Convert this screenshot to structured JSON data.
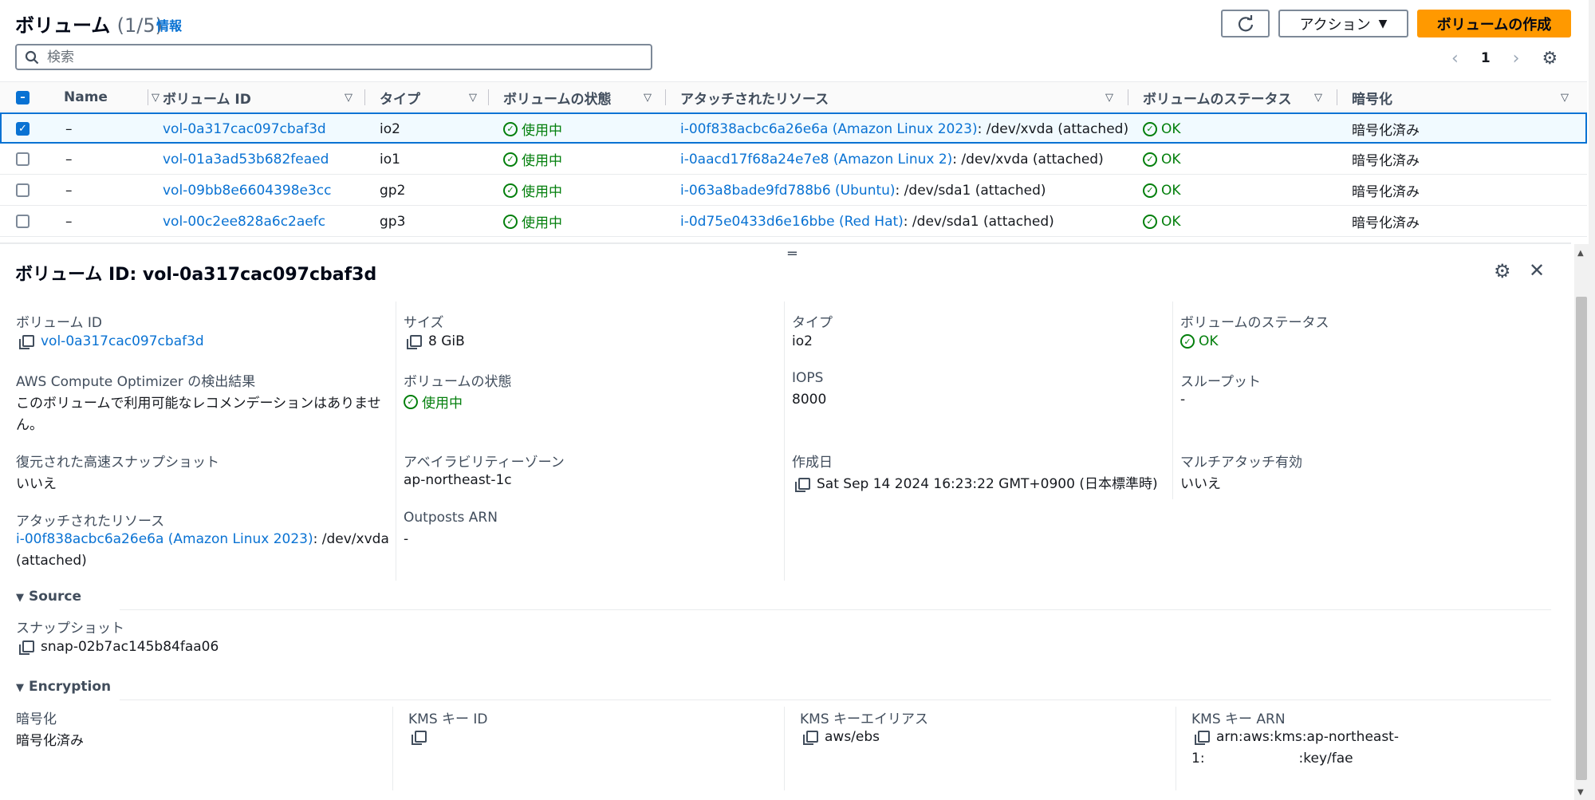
{
  "header": {
    "title": "ボリューム",
    "count": "(1/5)",
    "info": "情報",
    "actions_label": "アクション",
    "create_label": "ボリュームの作成"
  },
  "search": {
    "placeholder": "検索"
  },
  "pagination": {
    "current_page": "1"
  },
  "table": {
    "columns": [
      "Name",
      "ボリューム ID",
      "タイプ",
      "ボリュームの状態",
      "アタッチされたリソース",
      "ボリュームのステータス",
      "暗号化"
    ],
    "rows": [
      {
        "selected": true,
        "name": "–",
        "volume_id": "vol-0a317cac097cbaf3d",
        "type": "io2",
        "state": "使用中",
        "attached_link": "i-00f838acbc6a26e6a (Amazon Linux 2023)",
        "attached_suffix": ": /dev/xvda (attached)",
        "status": "OK",
        "encryption": "暗号化済み"
      },
      {
        "selected": false,
        "name": "–",
        "volume_id": "vol-01a3ad53b682feaed",
        "type": "io1",
        "state": "使用中",
        "attached_link": "i-0aacd17f68a24e7e8 (Amazon Linux 2)",
        "attached_suffix": ": /dev/xvda (attached)",
        "status": "OK",
        "encryption": "暗号化済み"
      },
      {
        "selected": false,
        "name": "–",
        "volume_id": "vol-09bb8e6604398e3cc",
        "type": "gp2",
        "state": "使用中",
        "attached_link": "i-063a8bade9fd788b6 (Ubuntu)",
        "attached_suffix": ": /dev/sda1 (attached)",
        "status": "OK",
        "encryption": "暗号化済み"
      },
      {
        "selected": false,
        "name": "–",
        "volume_id": "vol-00c2ee828a6c2aefc",
        "type": "gp3",
        "state": "使用中",
        "attached_link": "i-0d75e0433d6e16bbe (Red Hat)",
        "attached_suffix": ": /dev/sda1 (attached)",
        "status": "OK",
        "encryption": "暗号化済み"
      }
    ]
  },
  "detail": {
    "title": "ボリューム ID: vol-0a317cac097cbaf3d",
    "volume_id_label": "ボリューム ID",
    "volume_id": "vol-0a317cac097cbaf3d",
    "size_label": "サイズ",
    "size": "8 GiB",
    "type_label": "タイプ",
    "type": "io2",
    "status_label": "ボリュームのステータス",
    "status": "OK",
    "optimizer_label": "AWS Compute Optimizer の検出結果",
    "optimizer_line1": "このボリュームで利用可能なレコメンデーションはありませ",
    "optimizer_line2": "ん。",
    "state_label": "ボリュームの状態",
    "state": "使用中",
    "iops_label": "IOPS",
    "iops": "8000",
    "throughput_label": "スループット",
    "throughput": "-",
    "fsr_label": "復元された高速スナップショット",
    "fsr": "いいえ",
    "az_label": "アベイラビリティーゾーン",
    "az": "ap-northeast-1c",
    "created_label": "作成日",
    "created": "Sat Sep 14 2024 16:23:22 GMT+0900 (日本標準時)",
    "multiattach_label": "マルチアタッチ有効",
    "multiattach": "いいえ",
    "attached_label": "アタッチされたリソース",
    "attached_link": "i-00f838acbc6a26e6a (Amazon Linux 2023)",
    "attached_suffix": ": /dev/xvda",
    "attached_line2": "(attached)",
    "outposts_label": "Outposts ARN",
    "outposts": "-"
  },
  "source": {
    "heading": "Source",
    "snapshot_label": "スナップショット",
    "snapshot": "snap-02b7ac145b84faa06"
  },
  "encryption": {
    "heading": "Encryption",
    "enc_label": "暗号化",
    "enc": "暗号化済み",
    "kms_id_label": "KMS キー ID",
    "kms_alias_label": "KMS キーエイリアス",
    "kms_alias": "aws/ebs",
    "kms_arn_label": "KMS キー ARN",
    "kms_arn_line1": "arn:aws:kms:ap-northeast-",
    "kms_arn_line2_a": "1:",
    "kms_arn_line2_b": ":key/fae"
  },
  "colors": {
    "accent": "#0972d3",
    "primary_button": "#ff9900",
    "success": "#037f0c"
  }
}
